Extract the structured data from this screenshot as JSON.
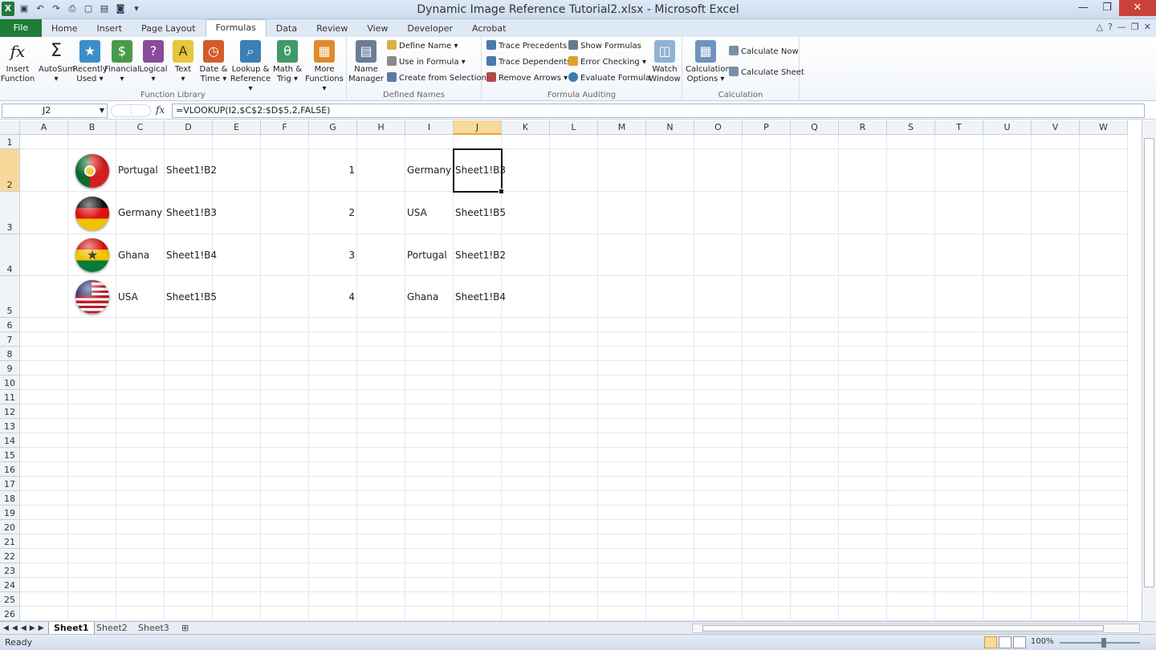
{
  "window": {
    "title": "Dynamic Image Reference Tutorial2.xlsx - Microsoft Excel",
    "controls": [
      "minimize",
      "restore",
      "close"
    ]
  },
  "quick_access": [
    "excel-logo",
    "save-icon",
    "undo-icon",
    "redo-icon",
    "print-preview-icon",
    "new-icon",
    "open-icon",
    "camera-icon",
    "customize-icon"
  ],
  "tabs": [
    "File",
    "Home",
    "Insert",
    "Page Layout",
    "Formulas",
    "Data",
    "Review",
    "View",
    "Developer",
    "Acrobat"
  ],
  "active_tab": "Formulas",
  "ribbon": {
    "function_library": {
      "label": "Function Library",
      "buttons": [
        {
          "label1": "Insert",
          "label2": "Function",
          "icon": "fx-icon"
        },
        {
          "label1": "AutoSum",
          "label2": "▾",
          "icon": "sigma-icon"
        },
        {
          "label1": "Recently",
          "label2": "Used ▾",
          "icon": "book-star-icon"
        },
        {
          "label1": "Financial",
          "label2": "▾",
          "icon": "book-financial-icon"
        },
        {
          "label1": "Logical",
          "label2": "▾",
          "icon": "book-logical-icon"
        },
        {
          "label1": "Text",
          "label2": "▾",
          "icon": "book-text-icon"
        },
        {
          "label1": "Date &",
          "label2": "Time ▾",
          "icon": "book-date-icon"
        },
        {
          "label1": "Lookup &",
          "label2": "Reference ▾",
          "icon": "book-lookup-icon"
        },
        {
          "label1": "Math &",
          "label2": "Trig ▾",
          "icon": "book-math-icon"
        },
        {
          "label1": "More",
          "label2": "Functions ▾",
          "icon": "book-more-icon"
        }
      ]
    },
    "defined_names": {
      "label": "Defined Names",
      "name_manager": {
        "label1": "Name",
        "label2": "Manager"
      },
      "define_name": "Define Name ▾",
      "use_in_formula": "Use in Formula ▾",
      "create_from_selection": "Create from Selection"
    },
    "formula_auditing": {
      "label": "Formula Auditing",
      "trace_precedents": "Trace Precedents",
      "trace_dependents": "Trace Dependents",
      "remove_arrows": "Remove Arrows ▾",
      "show_formulas": "Show Formulas",
      "error_checking": "Error Checking ▾",
      "evaluate_formula": "Evaluate Formula",
      "watch_window": {
        "label1": "Watch",
        "label2": "Window"
      }
    },
    "calculation": {
      "label": "Calculation",
      "calc_options": {
        "label1": "Calculation",
        "label2": "Options ▾"
      },
      "calculate_now": "Calculate Now",
      "calculate_sheet": "Calculate Sheet"
    }
  },
  "formula_bar": {
    "name_box": "J2",
    "fx": "fx",
    "formula": "=VLOOKUP(I2,$C$2:$D$5,2,FALSE)"
  },
  "columns": [
    "A",
    "B",
    "C",
    "D",
    "E",
    "F",
    "G",
    "H",
    "I",
    "J",
    "K",
    "L",
    "M",
    "N",
    "O",
    "P",
    "Q",
    "R",
    "S",
    "T",
    "U",
    "V",
    "W"
  ],
  "selected_column": "J",
  "rows": [
    "1",
    "2",
    "3",
    "4",
    "5",
    "6",
    "7",
    "8",
    "9",
    "10",
    "11",
    "12",
    "13",
    "14",
    "15",
    "16",
    "17",
    "18",
    "19",
    "20",
    "21",
    "22",
    "23",
    "24",
    "25",
    "26"
  ],
  "selected_row": "2",
  "cells": {
    "C2": "Portugal",
    "D2": "Sheet1!B2",
    "G2": "1",
    "I2": "Germany",
    "J2": "Sheet1!B3",
    "C3": "Germany",
    "D3": "Sheet1!B3",
    "G3": "2",
    "I3": "USA",
    "J3": "Sheet1!B5",
    "C4": "Ghana",
    "D4": "Sheet1!B4",
    "G4": "3",
    "I4": "Portugal",
    "J4": "Sheet1!B2",
    "C5": "USA",
    "D5": "Sheet1!B5",
    "G5": "4",
    "I5": "Ghana",
    "J5": "Sheet1!B4"
  },
  "flags": [
    {
      "cell": "B2",
      "icon": "portugal-flag-icon"
    },
    {
      "cell": "B3",
      "icon": "germany-flag-icon"
    },
    {
      "cell": "B4",
      "icon": "ghana-flag-icon"
    },
    {
      "cell": "B5",
      "icon": "usa-flag-icon"
    }
  ],
  "sheets": [
    "Sheet1",
    "Sheet2",
    "Sheet3"
  ],
  "active_sheet": "Sheet1",
  "status": {
    "text": "Ready",
    "zoom": "100%"
  }
}
